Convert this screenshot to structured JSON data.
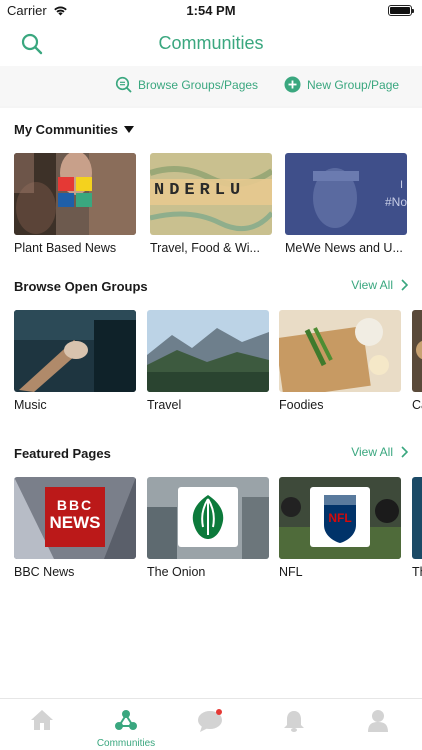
{
  "status_bar": {
    "carrier": "Carrier",
    "time": "1:54 PM"
  },
  "nav": {
    "title": "Communities"
  },
  "actions": {
    "browse_label": "Browse Groups/Pages",
    "new_label": "New Group/Page"
  },
  "my_communities": {
    "title": "My Communities",
    "items": [
      {
        "label": "Plant Based News"
      },
      {
        "label": "Travel, Food & Wi..."
      },
      {
        "label": "MeWe News and U..."
      }
    ]
  },
  "browse_open_groups": {
    "title": "Browse Open Groups",
    "view_all": "View All",
    "items": [
      {
        "label": "Music"
      },
      {
        "label": "Travel"
      },
      {
        "label": "Foodies"
      },
      {
        "label": "Ca"
      }
    ]
  },
  "featured_pages": {
    "title": "Featured Pages",
    "view_all": "View All",
    "items": [
      {
        "label": "BBC News"
      },
      {
        "label": "The Onion"
      },
      {
        "label": "NFL"
      },
      {
        "label": "Th"
      }
    ]
  },
  "thumb_text": {
    "scrabble": "NDERLU",
    "mewe_line1": "I",
    "mewe_line2": "#No",
    "bbc_line1": "BBC",
    "bbc_line2": "NEWS",
    "nfl": "NFL"
  },
  "tab_bar": {
    "communities_label": "Communities"
  },
  "colors": {
    "accent": "#3aa77f",
    "badge": "#e53935"
  }
}
